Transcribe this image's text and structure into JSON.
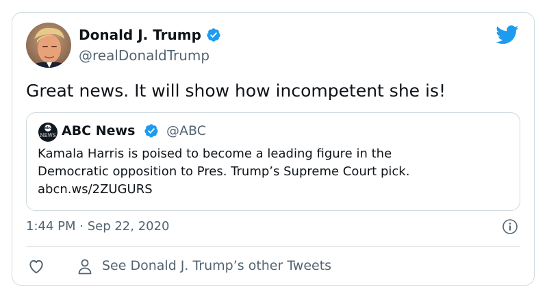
{
  "author": {
    "name": "Donald J. Trump",
    "handle": "@realDonaldTrump",
    "avatar": "avatar"
  },
  "tweet": {
    "text": "Great news. It will show how incompetent she is!"
  },
  "quoted": {
    "name": "ABC News",
    "handle": "@ABC",
    "avatar_top": "abc",
    "avatar_bottom": "NEWS",
    "lines": [
      "Kamala Harris is poised to become a leading figure in the",
      "Democratic opposition to Pres. Trump’s Supreme Court pick.",
      "abcn.ws/2ZUGURS"
    ]
  },
  "meta": {
    "timestamp": "1:44 PM · Sep 22, 2020"
  },
  "actions": {
    "other_tweets": "See Donald J. Trump’s other Tweets"
  },
  "icons": {
    "brand": "twitter-bird-icon",
    "verified": "verified-badge-icon",
    "info": "info-icon",
    "like": "heart-icon",
    "profile": "person-icon"
  },
  "colors": {
    "brand_blue": "#1d9bf0",
    "text": "#0f1419",
    "secondary_text": "#536471",
    "border": "#cfd9de"
  }
}
